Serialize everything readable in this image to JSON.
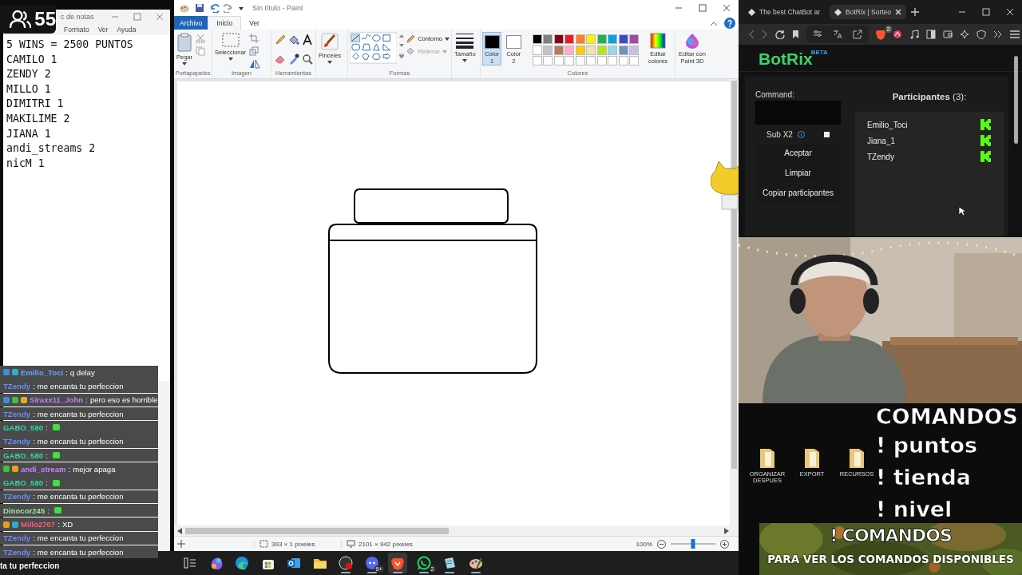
{
  "viewer_count": {
    "count": "55"
  },
  "notepad": {
    "title": "c de notas",
    "menu": [
      "Formato",
      "Ver",
      "Ayuda"
    ],
    "lines": [
      "5 WINS = 2500 PUNTOS",
      "CAMILO 1",
      "ZENDY 2",
      "MILLO 1",
      "DIMITRI 1",
      "MAKILIME 2",
      "JIANA 1",
      "andi_streams 2",
      "nicM 1"
    ]
  },
  "chat": {
    "messages": [
      {
        "user": "Emilio_Toci",
        "color": "#6aa0ff",
        "badges": [
          {
            "color": "#3b8fd6"
          },
          {
            "color": "#2ab0c9"
          }
        ],
        "separator": ":",
        "text": "q delay",
        "emote": false
      },
      {
        "user": "TZendy",
        "color": "#6a8cff",
        "separator": ":",
        "text": "me encanta tu perfeccion",
        "emote": false
      },
      {
        "user": "Siraxx11_John",
        "color": "#c080ff",
        "badges": [
          {
            "color": "#3b8fd6"
          },
          {
            "color": "#3fbf3f"
          },
          {
            "color": "#e0b020"
          }
        ],
        "separator": ":",
        "text": "pero eso es horrible",
        "emote": false
      },
      {
        "user": "TZendy",
        "color": "#6a8cff",
        "separator": ":",
        "text": "me encanta tu perfeccion",
        "emote": false
      },
      {
        "user": "GABO_580",
        "color": "#30d8a8",
        "separator": ":",
        "emote": true
      },
      {
        "user": "TZendy",
        "color": "#6a8cff",
        "separator": ":",
        "text": "me encanta tu perfeccion",
        "emote": false
      },
      {
        "user": "GABO_580",
        "color": "#30d8a8",
        "separator": ":",
        "emote": true
      },
      {
        "user": "andi_stream",
        "color": "#c880ff",
        "badges": [
          {
            "color": "#3fbf3f"
          },
          {
            "color": "#e0a020"
          }
        ],
        "separator": ":",
        "text": "mejor apaga",
        "emote": false
      },
      {
        "user": "GABO_580",
        "color": "#30d8a8",
        "separator": ":",
        "emote": true
      },
      {
        "user": "TZendy",
        "color": "#6a8cff",
        "separator": ":",
        "text": "me encanta tu perfeccion",
        "emote": false
      },
      {
        "user": "Dinocor245",
        "color": "#9ae89a",
        "separator": ":",
        "emote": true
      },
      {
        "user": "Millo2707",
        "color": "#ff5a78",
        "badges": [
          {
            "color": "#e0a020"
          },
          {
            "color": "#2ab0c9"
          }
        ],
        "separator": ":",
        "text": "XD",
        "emote": false
      },
      {
        "user": "TZendy",
        "color": "#6a8cff",
        "separator": ":",
        "text": "me encanta tu perfeccion",
        "emote": false
      },
      {
        "user": "TZendy",
        "color": "#6a8cff",
        "separator": ":",
        "text": "me encanta tu perfeccion",
        "emote": false
      }
    ],
    "overflow_line": "ta tu perfeccion"
  },
  "paint": {
    "title": "Sin título - Paint",
    "tabs": [
      {
        "label": "Archivo",
        "kind": "file",
        "selected": false
      },
      {
        "label": "Inicio",
        "kind": "tab",
        "selected": true
      },
      {
        "label": "Ver",
        "kind": "tab",
        "selected": false
      }
    ],
    "ribbon": {
      "clipboard": {
        "label": "Portapapeles",
        "paste": "Pegar"
      },
      "image": {
        "label": "Imagen",
        "select": "Seleccionar"
      },
      "tools": {
        "label": "Herramientas"
      },
      "brushes": {
        "button": "Pinceles"
      },
      "shapes": {
        "label": "Formas",
        "outline": {
          "label": "Contorno",
          "disabled": false
        },
        "fill": {
          "label": "Rellenar",
          "disabled": true
        }
      },
      "size": {
        "button": "Tamaño"
      },
      "colors": {
        "label": "Colores",
        "color1": {
          "label": "Color 1",
          "color": "#000000",
          "selected": true
        },
        "color2": {
          "label": "Color 2",
          "color": "#ffffff",
          "selected": false
        },
        "palette": [
          {
            "color": "#000000"
          },
          {
            "color": "#7f7f7f"
          },
          {
            "color": "#880015"
          },
          {
            "color": "#ed1c24"
          },
          {
            "color": "#ff7f27"
          },
          {
            "color": "#fff200"
          },
          {
            "color": "#22b14c"
          },
          {
            "color": "#00a2e8"
          },
          {
            "color": "#3f48cc"
          },
          {
            "color": "#a349a4"
          },
          {
            "color": "#ffffff"
          },
          {
            "color": "#c3c3c3"
          },
          {
            "color": "#b97a57"
          },
          {
            "color": "#ffaec9"
          },
          {
            "color": "#ffc90e"
          },
          {
            "color": "#efe4b0"
          },
          {
            "color": "#b5e61d"
          },
          {
            "color": "#99d9ea"
          },
          {
            "color": "#7092be"
          },
          {
            "color": "#c8bfe7"
          }
        ],
        "edit": "Editar colores"
      },
      "paint3d": "Editar con Paint 3D"
    },
    "status": {
      "selection": "393 × 1 píxeles",
      "canvas_size": "2101 × 942 píxeles",
      "zoom": "100%",
      "zoom_slider": {
        "level": 0.5
      }
    }
  },
  "taskbar": {
    "apps": [
      {
        "kind": "taskview",
        "running": false,
        "active": false
      },
      {
        "kind": "copilot",
        "running": false,
        "active": false
      },
      {
        "kind": "edge",
        "running": false,
        "active": false
      },
      {
        "kind": "store",
        "running": false,
        "active": false
      },
      {
        "kind": "outlook",
        "running": false,
        "active": false
      },
      {
        "kind": "explorer",
        "running": false,
        "active": false
      },
      {
        "kind": "obs",
        "running": true,
        "active": false
      },
      {
        "kind": "discord",
        "running": true,
        "active": false,
        "badge": "9+"
      },
      {
        "kind": "brave",
        "running": true,
        "active": true
      },
      {
        "kind": "whatsapp",
        "running": true,
        "active": false,
        "badge": "2"
      },
      {
        "kind": "notepad",
        "running": true,
        "active": false
      },
      {
        "kind": "paint",
        "running": true,
        "active": false
      }
    ]
  },
  "browser": {
    "tabs": [
      {
        "label": "The best ChatBot ar",
        "selected": false
      },
      {
        "label": "BotRix | Sorteo",
        "selected": true
      }
    ],
    "shield_badge": "2",
    "botrix": {
      "logo": "BotRix",
      "beta": "BETA",
      "command_label": "Command:",
      "sub_label": "Sub X2",
      "sub_checked": false,
      "buttons": [
        "Aceptar",
        "Limpiar",
        "Copiar participantes"
      ],
      "participants_title": "**Participantes** (3):",
      "participants": [
        {
          "name": "Emilio_Toci"
        },
        {
          "name": "Jiana_1"
        },
        {
          "name": "TZendy"
        }
      ]
    }
  },
  "stream_overlay": {
    "heading": "COMANDOS",
    "commands": [
      "! puntos",
      "! tienda",
      "! nivel"
    ],
    "banner_title": "! COMANDOS",
    "banner_subtitle": "PARA VER LOS COMANDOS DISPONIBLES"
  },
  "desktop_icons": [
    {
      "label": "ORGANIZAR DESPUES"
    },
    {
      "label": "EXPORT"
    },
    {
      "label": "RECURSOS"
    }
  ]
}
